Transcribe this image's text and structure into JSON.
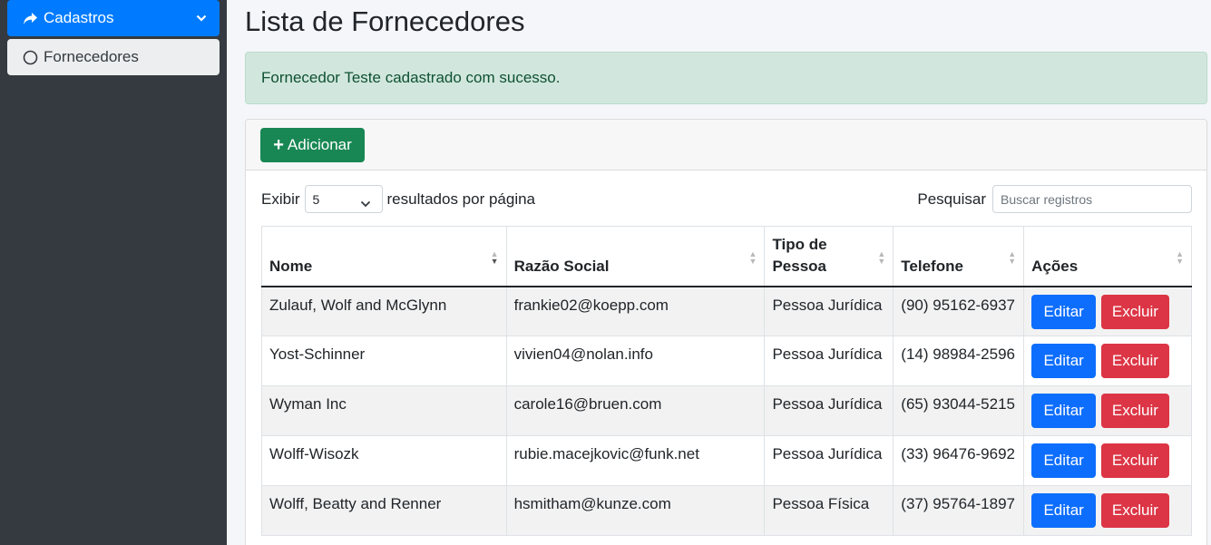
{
  "sidebar": {
    "group_label": "Cadastros",
    "item_label": "Fornecedores"
  },
  "page": {
    "title": "Lista de Fornecedores",
    "alert": "Fornecedor Teste cadastrado com sucesso."
  },
  "toolbar": {
    "add_label": "Adicionar"
  },
  "controls": {
    "show_label": "Exibir",
    "page_size": "5",
    "per_page_label": "resultados por página",
    "search_label": "Pesquisar",
    "search_placeholder": "Buscar registros"
  },
  "table": {
    "headers": {
      "nome": "Nome",
      "razao": "Razão Social",
      "tipo_1": "Tipo de",
      "tipo_2": "Pessoa",
      "telefone": "Telefone",
      "acoes": "Ações"
    },
    "rows": [
      {
        "nome": "Zulauf, Wolf and McGlynn",
        "razao": "frankie02@koepp.com",
        "tipo": "Pessoa Jurídica",
        "telefone": "(90) 95162-6937"
      },
      {
        "nome": "Yost-Schinner",
        "razao": "vivien04@nolan.info",
        "tipo": "Pessoa Jurídica",
        "telefone": "(14) 98984-2596"
      },
      {
        "nome": "Wyman Inc",
        "razao": "carole16@bruen.com",
        "tipo": "Pessoa Jurídica",
        "telefone": "(65) 93044-5215"
      },
      {
        "nome": "Wolff-Wisozk",
        "razao": "rubie.macejkovic@funk.net",
        "tipo": "Pessoa Jurídica",
        "telefone": "(33) 96476-9692"
      },
      {
        "nome": "Wolff, Beatty and Renner",
        "razao": "hsmitham@kunze.com",
        "tipo": "Pessoa Física",
        "telefone": "(37) 95764-1897"
      }
    ],
    "edit_label": "Editar",
    "delete_label": "Excluir"
  },
  "colors": {
    "primary": "#0d6efd",
    "success": "#198754",
    "danger": "#dc3545",
    "sidebar": "#343a40",
    "alert_bg": "#d1e7dd"
  },
  "icons": {
    "group": "share-arrow-icon",
    "chevron": "chevron-down-icon",
    "item": "circle-outline-icon",
    "add": "plus-icon"
  }
}
